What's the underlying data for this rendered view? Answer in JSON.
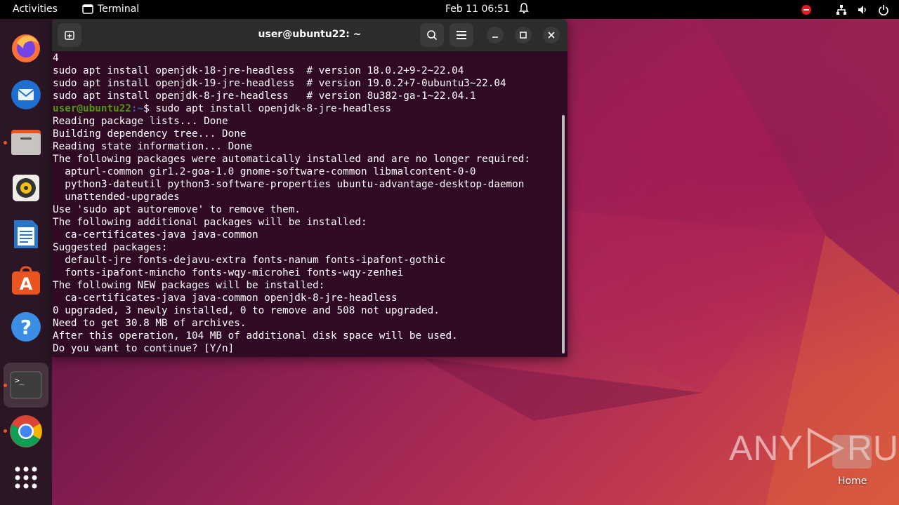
{
  "topbar": {
    "activities": "Activities",
    "app_name": "Terminal",
    "clock": "Feb 11  06:51"
  },
  "terminal": {
    "title": "user@ubuntu22: ~",
    "prompt_user": "user@ubuntu22",
    "prompt_path": ":~",
    "prompt_command": "$ sudo apt install openjdk-8-jre-headless",
    "lines_before": [
      "4",
      "sudo apt install openjdk-18-jre-headless  # version 18.0.2+9-2~22.04",
      "sudo apt install openjdk-19-jre-headless  # version 19.0.2+7-0ubuntu3~22.04",
      "sudo apt install openjdk-8-jre-headless   # version 8u382-ga-1~22.04.1"
    ],
    "lines_after": [
      "Reading package lists... Done",
      "Building dependency tree... Done",
      "Reading state information... Done",
      "The following packages were automatically installed and are no longer required:",
      "  apturl-common gir1.2-goa-1.0 gnome-software-common libmalcontent-0-0",
      "  python3-dateutil python3-software-properties ubuntu-advantage-desktop-daemon",
      "  unattended-upgrades",
      "Use 'sudo apt autoremove' to remove them.",
      "The following additional packages will be installed:",
      "  ca-certificates-java java-common",
      "Suggested packages:",
      "  default-jre fonts-dejavu-extra fonts-nanum fonts-ipafont-gothic",
      "  fonts-ipafont-mincho fonts-wqy-microhei fonts-wqy-zenhei",
      "The following NEW packages will be installed:",
      "  ca-certificates-java java-common openjdk-8-jre-headless",
      "0 upgraded, 3 newly installed, 0 to remove and 508 not upgraded.",
      "Need to get 30.8 MB of archives.",
      "After this operation, 104 MB of additional disk space will be used.",
      "Do you want to continue? [Y/n]"
    ]
  },
  "dock": {
    "items": [
      "firefox-icon",
      "thunderbird-icon",
      "files-icon",
      "rhythmbox-icon",
      "writer-icon",
      "software-icon",
      "help-icon",
      "terminal-icon",
      "chrome-icon",
      "app-grid-icon"
    ]
  },
  "desktop": {
    "watermark": "ANY RUN",
    "home_label": "Home"
  },
  "colors": {
    "terminal_bg": "#300a24",
    "prompt_user": "#4e9a06",
    "prompt_path": "#3465a4",
    "accent": "#e95420"
  }
}
